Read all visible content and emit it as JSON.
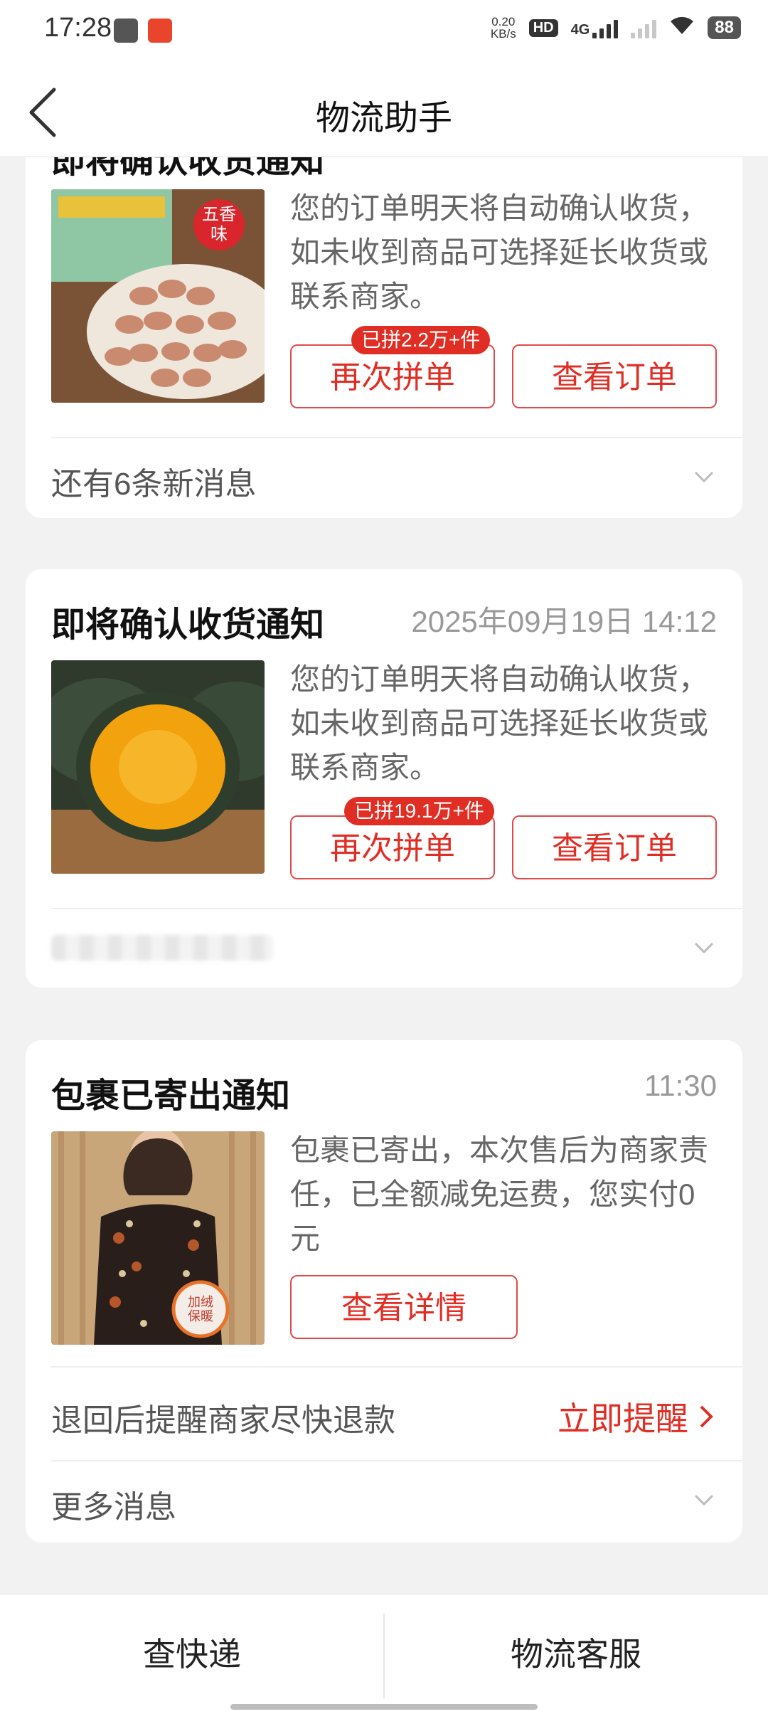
{
  "status_bar": {
    "time": "17:28",
    "net_speed_value": "0.20",
    "net_speed_unit": "KB/s",
    "hd_label": "HD",
    "network_type": "4G",
    "battery": "88"
  },
  "header": {
    "title": "物流助手"
  },
  "cards": [
    {
      "title": "即将确认收货通知",
      "description": "您的订单明天将自动确认收货，如未收到商品可选择延长收货或联系商家。",
      "thumb_text": "五香味",
      "buttons": {
        "reorder": "再次拼单",
        "reorder_badge": "已拼2.2万+件",
        "view_order": "查看订单"
      },
      "footer": "还有6条新消息"
    },
    {
      "title": "即将确认收货通知",
      "time": "2025年09月19日 14:12",
      "description": "您的订单明天将自动确认收货，如未收到商品可选择延长收货或联系商家。",
      "buttons": {
        "reorder": "再次拼单",
        "reorder_badge": "已拼19.1万+件",
        "view_order": "查看订单"
      }
    },
    {
      "title": "包裹已寄出通知",
      "time": "11:30",
      "description": "包裹已寄出，本次售后为商家责任，已全额减免运费，您实付0元",
      "thumb_badge": "加绒保暖",
      "buttons": {
        "view_detail": "查看详情"
      },
      "remind_row": {
        "text": "退回后提醒商家尽快退款",
        "action": "立即提醒"
      },
      "footer": "更多消息"
    }
  ],
  "bottom_bar": {
    "left": "查快递",
    "right": "物流客服"
  },
  "colors": {
    "accent": "#e02e24",
    "background": "#f2f2f2"
  }
}
